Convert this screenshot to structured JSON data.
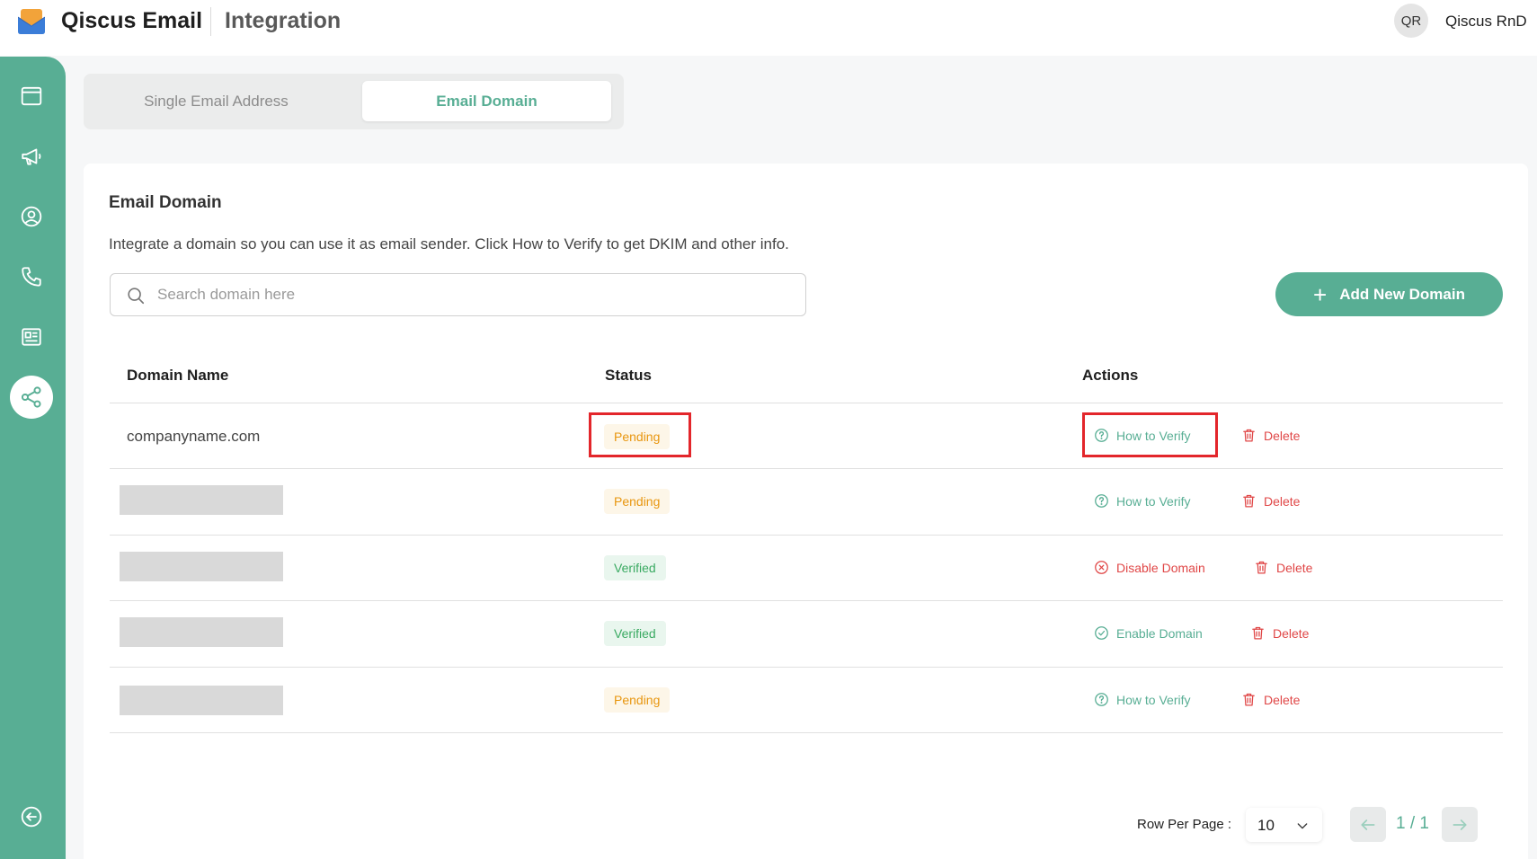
{
  "header": {
    "app_name": "Qiscus Email",
    "page_name": "Integration",
    "user_initials": "QR",
    "user_name": "Qiscus RnD"
  },
  "sidebar": {
    "items": [
      {
        "icon": "browser-window-icon"
      },
      {
        "icon": "megaphone-icon"
      },
      {
        "icon": "user-circle-icon"
      },
      {
        "icon": "phone-icon"
      },
      {
        "icon": "newspaper-icon"
      },
      {
        "icon": "share-icon",
        "active": true
      },
      {
        "icon": "collapse-arrow-icon"
      }
    ]
  },
  "tabs": [
    {
      "label": "Single Email Address",
      "active": false
    },
    {
      "label": "Email Domain",
      "active": true
    }
  ],
  "section": {
    "title": "Email Domain",
    "description": "Integrate a domain so you can use it as email sender. Click How to Verify to get DKIM and other info."
  },
  "search": {
    "placeholder": "Search domain here",
    "value": ""
  },
  "add_button": {
    "label": "Add New Domain"
  },
  "table": {
    "columns": [
      "Domain Name",
      "Status",
      "Actions"
    ],
    "rows": [
      {
        "domain": "companyname.com",
        "status": "Pending",
        "primary_action": "How to Verify",
        "secondary_action": "Delete"
      },
      {
        "domain": "",
        "status": "Pending",
        "primary_action": "How to Verify",
        "secondary_action": "Delete"
      },
      {
        "domain": "",
        "status": "Verified",
        "primary_action": "Disable Domain",
        "secondary_action": "Delete"
      },
      {
        "domain": "",
        "status": "Verified",
        "primary_action": "Enable Domain",
        "secondary_action": "Delete"
      },
      {
        "domain": "",
        "status": "Pending",
        "primary_action": "How to Verify",
        "secondary_action": "Delete"
      }
    ]
  },
  "pagination": {
    "rows_per_page_label": "Row Per Page :",
    "rows_per_page_value": "10",
    "page_indicator": "1 / 1"
  },
  "colors": {
    "accent": "#58ae94",
    "pending": "#e8960f",
    "verified": "#3aaa62",
    "danger": "#e04747",
    "highlight": "#e3262b"
  }
}
